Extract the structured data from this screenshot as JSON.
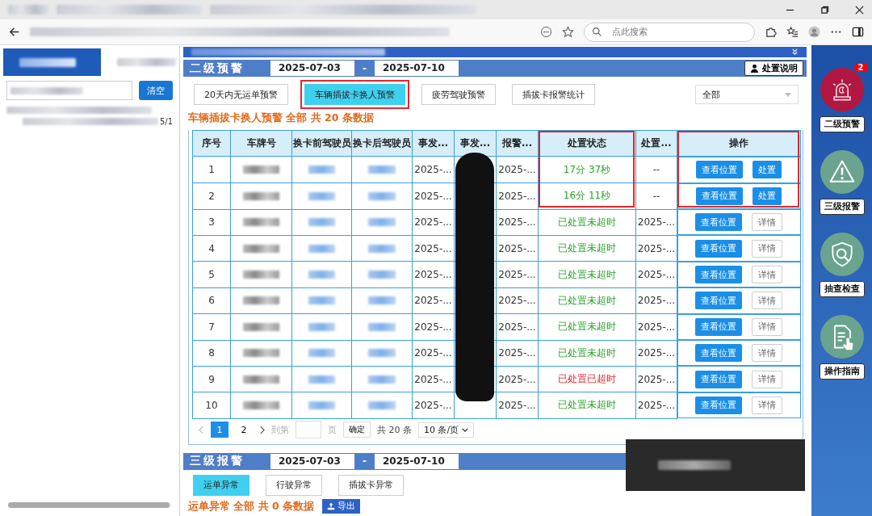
{
  "browser": {
    "search_placeholder": "点此搜索"
  },
  "left_panel": {
    "clear_button": "清空",
    "tree_item_tail": "5/1"
  },
  "level2": {
    "title": "二级预警",
    "date_from": "2025-07-03",
    "date_sep": "-",
    "date_to": "2025-07-10",
    "help_button": "处置说明",
    "tabs": [
      {
        "label": "20天内无运单预警",
        "selected": false,
        "annotated": false
      },
      {
        "label": "车辆插拔卡换人预警",
        "selected": true,
        "annotated": true
      },
      {
        "label": "疲劳驾驶预警",
        "selected": false,
        "annotated": false
      },
      {
        "label": "插拔卡报警统计",
        "selected": false,
        "annotated": false
      }
    ],
    "filter": "全部",
    "summary": "车辆插拔卡换人预警 全部 共 20 条数据",
    "columns": [
      {
        "label": "序号",
        "annotated": false
      },
      {
        "label": "车牌号",
        "annotated": false
      },
      {
        "label": "换卡前驾驶员",
        "annotated": false
      },
      {
        "label": "换卡后驾驶员",
        "annotated": false
      },
      {
        "label": "事发...",
        "annotated": false
      },
      {
        "label": "事发...",
        "annotated": false
      },
      {
        "label": "报警...",
        "annotated": false
      },
      {
        "label": "处置状态",
        "annotated": true
      },
      {
        "label": "处置...",
        "annotated": false
      },
      {
        "label": "操作",
        "annotated": true
      }
    ],
    "rows": [
      {
        "no": "1",
        "event_time": "2025-...",
        "alarm_time": "2025-...",
        "status": "17分 37秒",
        "overdue": false,
        "handled_at": "--",
        "actions": [
          {
            "label": "查看位置",
            "kind": "primary"
          },
          {
            "label": "处置",
            "kind": "primary"
          }
        ]
      },
      {
        "no": "2",
        "event_time": "2025-...",
        "alarm_time": "2025-...",
        "status": "16分 11秒",
        "overdue": false,
        "handled_at": "--",
        "actions": [
          {
            "label": "查看位置",
            "kind": "primary"
          },
          {
            "label": "处置",
            "kind": "primary"
          }
        ]
      },
      {
        "no": "3",
        "event_time": "2025-...",
        "alarm_time": "2025-...",
        "status": "已处置未超时",
        "overdue": false,
        "handled_at": "2025-...",
        "actions": [
          {
            "label": "查看位置",
            "kind": "primary"
          },
          {
            "label": "详情",
            "kind": "plain"
          }
        ]
      },
      {
        "no": "4",
        "event_time": "2025-...",
        "alarm_time": "2025-...",
        "status": "已处置未超时",
        "overdue": false,
        "handled_at": "2025-...",
        "actions": [
          {
            "label": "查看位置",
            "kind": "primary"
          },
          {
            "label": "详情",
            "kind": "plain"
          }
        ]
      },
      {
        "no": "5",
        "event_time": "2025-...",
        "alarm_time": "2025-...",
        "status": "已处置未超时",
        "overdue": false,
        "handled_at": "2025-...",
        "actions": [
          {
            "label": "查看位置",
            "kind": "primary"
          },
          {
            "label": "详情",
            "kind": "plain"
          }
        ]
      },
      {
        "no": "6",
        "event_time": "2025-...",
        "alarm_time": "2025-...",
        "status": "已处置未超时",
        "overdue": false,
        "handled_at": "2025-...",
        "actions": [
          {
            "label": "查看位置",
            "kind": "primary"
          },
          {
            "label": "详情",
            "kind": "plain"
          }
        ]
      },
      {
        "no": "7",
        "event_time": "2025-...",
        "alarm_time": "2025-...",
        "status": "已处置未超时",
        "overdue": false,
        "handled_at": "2025-...",
        "actions": [
          {
            "label": "查看位置",
            "kind": "primary"
          },
          {
            "label": "详情",
            "kind": "plain"
          }
        ]
      },
      {
        "no": "8",
        "event_time": "2025-...",
        "alarm_time": "2025-...",
        "status": "已处置未超时",
        "overdue": false,
        "handled_at": "2025-...",
        "actions": [
          {
            "label": "查看位置",
            "kind": "primary"
          },
          {
            "label": "详情",
            "kind": "plain"
          }
        ]
      },
      {
        "no": "9",
        "event_time": "2025-...",
        "alarm_time": "2025-...",
        "status": "已处置已超时",
        "overdue": true,
        "handled_at": "2025-...",
        "actions": [
          {
            "label": "查看位置",
            "kind": "primary"
          },
          {
            "label": "详情",
            "kind": "plain"
          }
        ]
      },
      {
        "no": "10",
        "event_time": "2025-...",
        "alarm_time": "2025-...",
        "status": "已处置未超时",
        "overdue": false,
        "handled_at": "2025-...",
        "actions": [
          {
            "label": "查看位置",
            "kind": "primary"
          },
          {
            "label": "详情",
            "kind": "plain"
          }
        ]
      }
    ],
    "pagination": {
      "pages": [
        {
          "label": "1",
          "selected": true
        },
        {
          "label": "2",
          "selected": false
        }
      ],
      "goto_label": "到第",
      "page_unit": "页",
      "confirm": "确定",
      "total": "共 20 条",
      "page_size": "10 条/页"
    }
  },
  "level3": {
    "title": "三级报警",
    "date_from": "2025-07-03",
    "date_sep": "-",
    "date_to": "2025-07-10",
    "tabs": [
      {
        "label": "运单异常",
        "selected": true
      },
      {
        "label": "行驶异常",
        "selected": false
      },
      {
        "label": "插拔卡异常",
        "selected": false
      }
    ],
    "summary": "运单异常 全部 共 0 条数据",
    "export_button": "导出"
  },
  "sidebar": [
    {
      "kind": "siren",
      "label": "二级预警",
      "selected": true,
      "badge": "2"
    },
    {
      "kind": "warning",
      "label": "三级报警",
      "selected": false
    },
    {
      "kind": "inspect",
      "label": "抽查检查",
      "selected": false
    },
    {
      "kind": "guide",
      "label": "操作指南",
      "selected": false
    }
  ]
}
